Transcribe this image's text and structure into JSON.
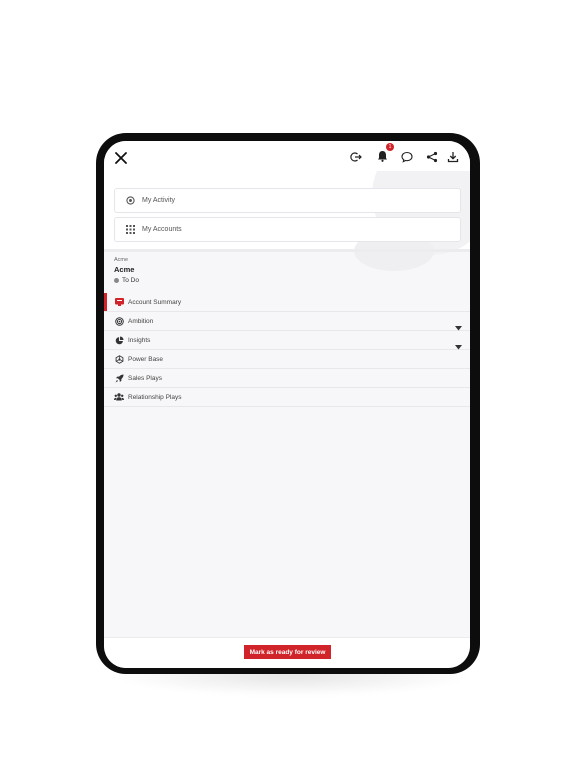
{
  "topbar": {
    "icons": [
      "close-icon",
      "logout-icon",
      "bell-icon",
      "chat-icon",
      "share-icon",
      "download-icon"
    ],
    "notification_count": "1"
  },
  "menu": {
    "activity_label": "My Activity",
    "accounts_label": "My Accounts"
  },
  "account": {
    "small_label": "Acme",
    "name": "Acme",
    "status": "To Do"
  },
  "nav": {
    "items": [
      {
        "label": "Account Summary",
        "icon": "account-summary-icon",
        "active": true
      },
      {
        "label": "Ambition",
        "icon": "target-icon",
        "expandable": true
      },
      {
        "label": "Insights",
        "icon": "pie-chart-icon",
        "expandable": true
      },
      {
        "label": "Power Base",
        "icon": "network-icon"
      },
      {
        "label": "Sales Plays",
        "icon": "rocket-icon"
      },
      {
        "label": "Relationship Plays",
        "icon": "people-icon"
      }
    ]
  },
  "footer": {
    "cta_label": "Mark as ready for review"
  },
  "colors": {
    "accent": "#d0232a",
    "device": "#0d0d0d",
    "screen_bg": "#f7f7f9"
  }
}
